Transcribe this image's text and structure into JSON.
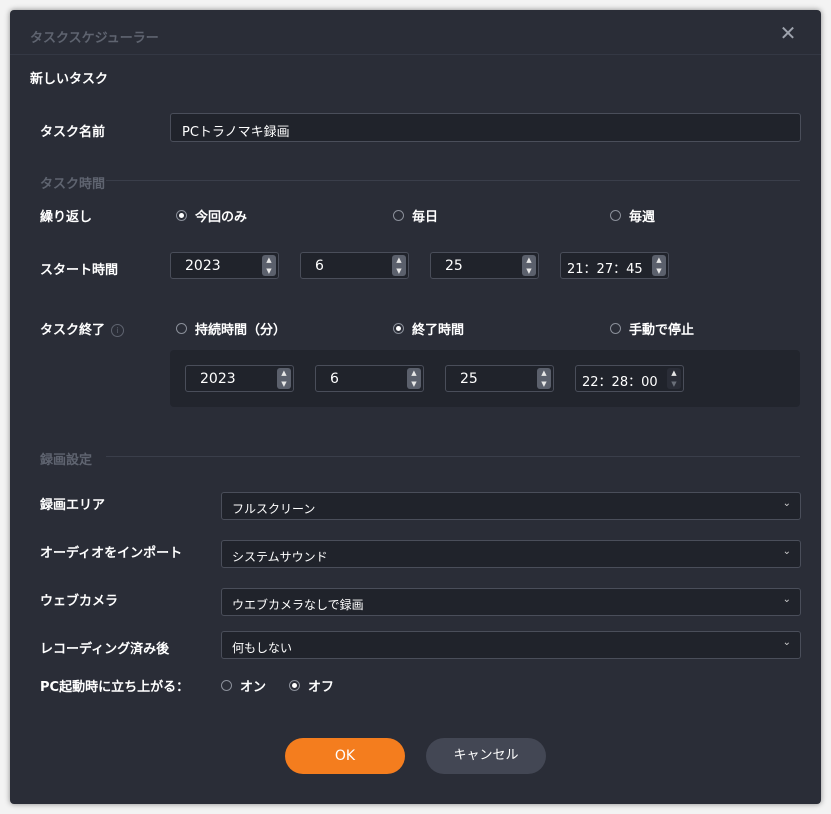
{
  "window": {
    "title": "タスクスケジューラー",
    "close_icon": "close-icon"
  },
  "new_task": "新しいタスク",
  "task_name": {
    "label": "タスク名前",
    "value": "PCトラノマキ録画"
  },
  "task_time_section": "タスク時間",
  "repeat": {
    "label": "繰り返し",
    "options": [
      "今回のみ",
      "毎日",
      "毎週"
    ],
    "selected": "今回のみ"
  },
  "start_time": {
    "label": "スタート時間",
    "year": "2023",
    "month": "6",
    "day": "25",
    "time": "21：27：45"
  },
  "task_end": {
    "label": "タスク終了",
    "info_icon": "info-icon",
    "options": [
      "持続時間（分）",
      "終了時間",
      "手動で停止"
    ],
    "selected": "終了時間",
    "year": "2023",
    "month": "6",
    "day": "25",
    "time": "22：28：00"
  },
  "record_section": "録画設定",
  "record_area": {
    "label": "録画エリア",
    "value": "フルスクリーン"
  },
  "audio_input": {
    "label": "オーディオをインポート",
    "value": "システムサウンド"
  },
  "webcam": {
    "label": "ウェブカメラ",
    "value": "ウエブカメラなしで録画"
  },
  "after_recording": {
    "label": "レコーディング済み後",
    "value": "何もしない"
  },
  "startup": {
    "label": "PC起動時に立ち上がる：",
    "options": [
      "オン",
      "オフ"
    ],
    "selected": "オフ"
  },
  "buttons": {
    "ok": "OK",
    "cancel": "キャンセル"
  },
  "colors": {
    "background": "#2a2d37",
    "accent": "#f47d1e",
    "field": "#20232b"
  }
}
